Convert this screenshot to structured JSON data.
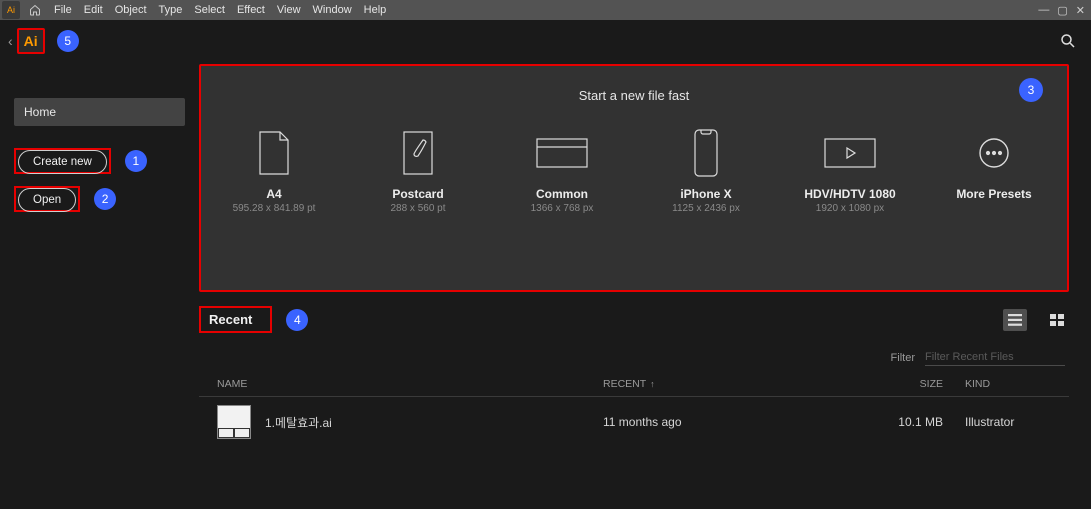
{
  "menu": {
    "items": [
      "File",
      "Edit",
      "Object",
      "Type",
      "Select",
      "Effect",
      "View",
      "Window",
      "Help"
    ]
  },
  "app_logo_text": "Ai",
  "annotations": {
    "ai": "5",
    "create": "1",
    "open": "2",
    "panel": "3",
    "recent": "4"
  },
  "sidebar": {
    "home": "Home",
    "create_new": "Create new",
    "open": "Open"
  },
  "panel": {
    "title": "Start a new file fast",
    "presets": [
      {
        "label": "A4",
        "dims": "595.28 x 841.89 pt",
        "icon": "page"
      },
      {
        "label": "Postcard",
        "dims": "288 x 560 pt",
        "icon": "brush"
      },
      {
        "label": "Common",
        "dims": "1366 x 768 px",
        "icon": "browser"
      },
      {
        "label": "iPhone X",
        "dims": "1125 x 2436 px",
        "icon": "phone"
      },
      {
        "label": "HDV/HDTV 1080",
        "dims": "1920 x 1080 px",
        "icon": "play"
      },
      {
        "label": "More Presets",
        "dims": "",
        "icon": "more"
      }
    ]
  },
  "recent": {
    "label": "Recent",
    "filter_label": "Filter",
    "filter_placeholder": "Filter Recent Files",
    "columns": {
      "name": "NAME",
      "recent": "RECENT",
      "size": "SIZE",
      "kind": "KIND"
    },
    "rows": [
      {
        "name": "1.메탈효과.ai",
        "recent": "11 months ago",
        "size": "10.1 MB",
        "kind": "Illustrator"
      }
    ]
  }
}
